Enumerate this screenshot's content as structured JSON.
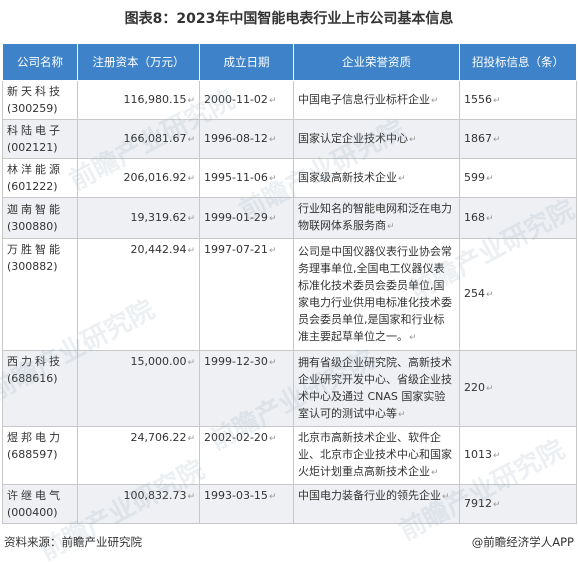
{
  "title": "图表8：2023年中国智能电表行业上市公司基本信息",
  "headers": [
    "公司名称",
    "注册资本（万元）",
    "成立日期",
    "企业荣誉资质",
    "招投标信息（条）"
  ],
  "rows": [
    {
      "name": "新天科技",
      "code": "(300259)",
      "capital": "116,980.15",
      "date": "2000-11-02",
      "honor": "中国电子信息行业标杆企业",
      "bids": "1556"
    },
    {
      "name": "科陆电子",
      "code": "(002121)",
      "capital": "166,081.67",
      "date": "1996-08-12",
      "honor": "国家认定企业技术中心",
      "bids": "1867"
    },
    {
      "name": "林洋能源",
      "code": "(601222)",
      "capital": "206,016.92",
      "date": "1995-11-06",
      "honor": "国家级高新技术企业",
      "bids": "599"
    },
    {
      "name": "迦南智能",
      "code": "(300880)",
      "capital": "19,319.62",
      "date": "1999-01-29",
      "honor": "行业知名的智能电网和泛在电力物联网体系服务商",
      "bids": "168"
    },
    {
      "name": "万胜智能",
      "code": "(300882)",
      "capital": "20,442.94",
      "date": "1997-07-21",
      "honor": "公司是中国仪器仪表行业协会常务理事单位,全国电工仪器仪表标准化技术委员会委员单位,国家电力行业供用电标准化技术委员会委员单位,是国家和行业标准主要起草单位之一。",
      "bids": "254"
    },
    {
      "name": "西力科技",
      "code": "(688616)",
      "capital": "15,000.00",
      "date": "1999-12-30",
      "honor": "拥有省级企业研究院、高新技术企业研究开发中心、省级企业技术中心及通过 CNAS 国家实验室认可的测试中心等",
      "bids": "220"
    },
    {
      "name": "煜邦电力",
      "code": "(688597)",
      "capital": "24,706.22",
      "date": "2002-02-20",
      "honor": "北京市高新技术企业、软件企业、北京市企业技术中心和国家火炬计划重点高新技术企业",
      "bids": "1013"
    },
    {
      "name": "许继电气",
      "code": "(000400)",
      "capital": "100,832.73",
      "date": "1993-03-15",
      "honor": "中国电力装备行业的领先企业",
      "bids": "7912"
    }
  ],
  "footer": {
    "source": "资料来源：前瞻产业研究院",
    "brand": "@前瞻经济学人APP"
  },
  "watermark": "前瞻产业研究院"
}
